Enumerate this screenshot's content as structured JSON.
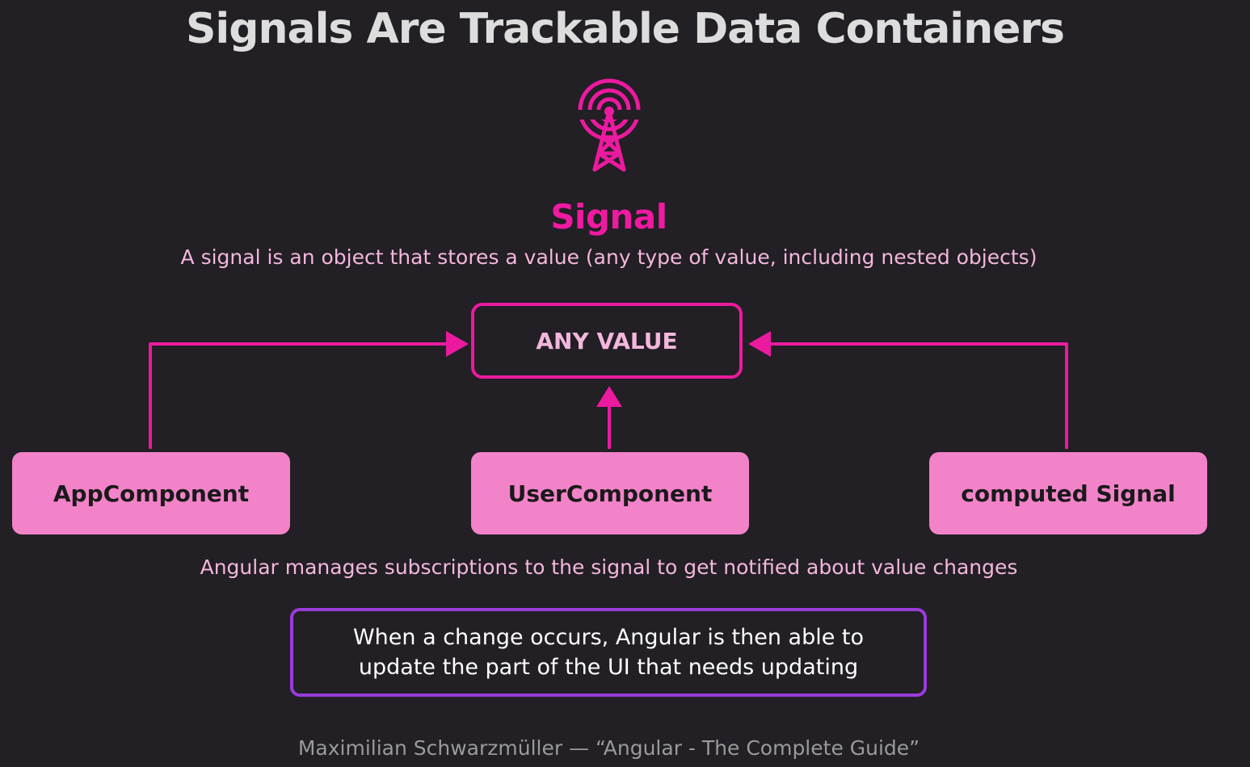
{
  "title": "Signals Are Trackable Data Containers",
  "icon": "radio-tower-icon",
  "signal": {
    "heading": "Signal",
    "description": "A signal is an object that stores a value (any type of value, including nested objects)"
  },
  "value_box": {
    "label": "ANY VALUE"
  },
  "components": [
    {
      "label": "AppComponent"
    },
    {
      "label": "UserComponent"
    },
    {
      "label": "computed Signal"
    }
  ],
  "subscription_text": "Angular manages subscriptions to the signal to get notified about value changes",
  "note": {
    "line1": "When a change occurs, Angular is then able to",
    "line2": "update the part of the UI that needs updating"
  },
  "footer": "Maximilian Schwarzmüller — “Angular - The Complete Guide”",
  "colors": {
    "background": "#221f25",
    "accent": "#ec1a9f",
    "component_fill": "#f383c9",
    "note_border": "#9a3bdb",
    "light_text": "#f3b7dc"
  }
}
